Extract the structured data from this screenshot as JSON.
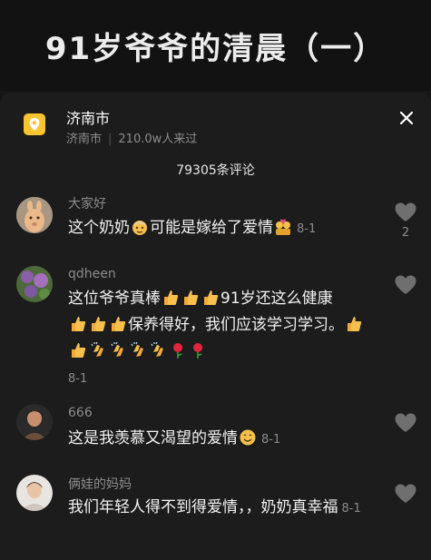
{
  "video": {
    "title": "91岁爷爷的清晨（一）"
  },
  "location": {
    "title": "济南市",
    "city": "济南市",
    "separator": "|",
    "visitors": "210.0w人来过"
  },
  "comments_header": {
    "count_label": "79305条评论"
  },
  "comments": [
    {
      "user": "大家好",
      "text_a": "这个奶奶",
      "text_b": "可能是嫁给了爱情",
      "time": "8-1",
      "likes": "2"
    },
    {
      "user": "qdheen",
      "text_a": "这位爷爷真棒",
      "text_b": "91岁还这么健康",
      "text_c": "保养得好，我们应该学习学习。",
      "time": "8-1"
    },
    {
      "user": "666",
      "text_a": "这是我羡慕又渴望的爱情",
      "time": "8-1"
    },
    {
      "user": "俩娃的妈妈",
      "text_a": "我们年轻人得不到得爱情，，奶奶真幸福",
      "time": "8-1"
    }
  ],
  "colors": {
    "panel": "#1c1c1c",
    "accent_location": "#f7c531",
    "muted_text": "#8c8c8c"
  }
}
